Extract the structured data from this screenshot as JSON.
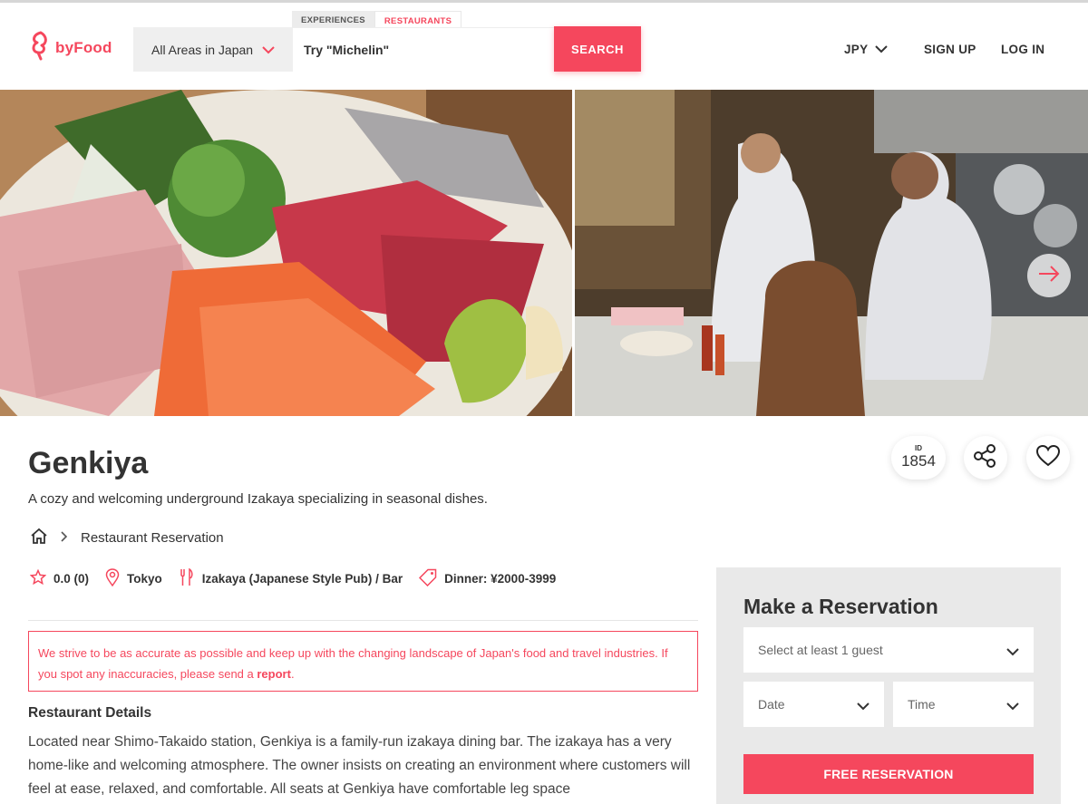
{
  "header": {
    "logo_text": "byFood",
    "area_select": "All Areas in Japan",
    "tabs": [
      "EXPERIENCES",
      "RESTAURANTS"
    ],
    "search_placeholder": "Try \"Michelin\"",
    "search_button": "SEARCH",
    "currency": "JPY",
    "sign_up": "SIGN UP",
    "log_in": "LOG IN"
  },
  "restaurant": {
    "name": "Genkiya",
    "tagline": "A cozy and welcoming underground Izakaya specializing in seasonal dishes.",
    "id_label": "ID",
    "id_value": "1854",
    "breadcrumb": "Restaurant Reservation",
    "rating": "0.0 (0)",
    "location": "Tokyo",
    "cuisine": "Izakaya (Japanese Style Pub) / Bar",
    "price": "Dinner: ¥2000-3999"
  },
  "notice": {
    "text": "We strive to be as accurate as possible and keep up with the changing landscape of Japan's food and travel industries. If you spot any inaccuracies, please send a ",
    "link": "report",
    "end": "."
  },
  "details": {
    "title": "Restaurant Details",
    "body": "Located near Shimo-Takaido station, Genkiya is a family-run izakaya dining bar. The izakaya has a very home-like and welcoming atmosphere. The owner insists on creating an environment where customers will feel at ease, relaxed, and comfortable. All seats at Genkiya have comfortable leg space"
  },
  "reservation": {
    "title": "Make a Reservation",
    "guest_placeholder": "Select at least 1 guest",
    "date_placeholder": "Date",
    "time_placeholder": "Time",
    "button": "FREE RESERVATION"
  },
  "colors": {
    "brand": "#f5475d",
    "panel": "#e9e9e9"
  }
}
